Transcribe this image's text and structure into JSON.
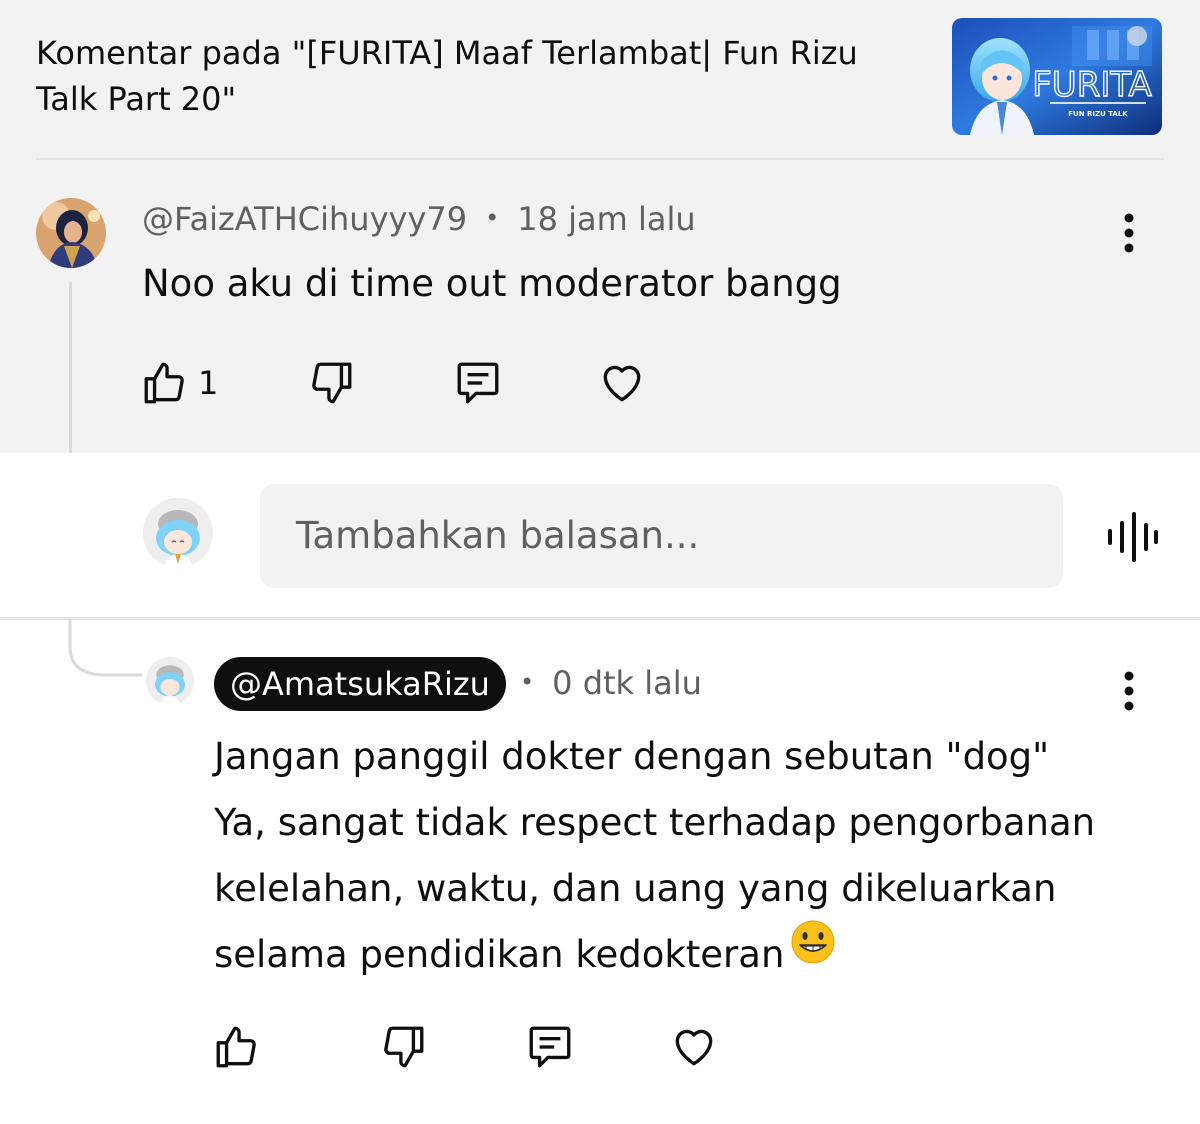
{
  "header": {
    "title": "Komentar pada \"[FURITA] Maaf Terlambat| Fun Rizu Talk Part 20\"",
    "thumbnail": {
      "icon": "video-thumbnail",
      "logo_text": "FURITA",
      "subtitle": "FUN RIZU TALK"
    }
  },
  "parent_comment": {
    "author": "@FaizATHCihuyyy79",
    "separator": "•",
    "time": "18 jam lalu",
    "text": "Noo aku di time out moderator bangg",
    "like_count": "1",
    "icons": {
      "like": "thumbs-up-icon",
      "dislike": "thumbs-down-icon",
      "reply": "reply-icon",
      "heart": "heart-icon",
      "menu": "more-vertical-icon"
    }
  },
  "reply_composer": {
    "placeholder": "Tambahkan balasan...",
    "mic_icon": "voice-wave-icon"
  },
  "reply_comment": {
    "author": "@AmatsukaRizu",
    "separator": "•",
    "time": "0 dtk lalu",
    "lines": [
      "Jangan panggil dokter dengan sebutan \"dog\"",
      "Ya, sangat tidak respect terhadap pengorbanan",
      "kelelahan, waktu, dan uang yang dikeluarkan",
      "selama pendidikan kedokteran"
    ],
    "emoji": "grinning-face-emoji"
  },
  "colors": {
    "background_top": "#f2f2f2",
    "text": "#0f0f0f",
    "meta": "#606060",
    "pill": "#0f0f0f",
    "accent_blue": "#2a6fd6"
  }
}
